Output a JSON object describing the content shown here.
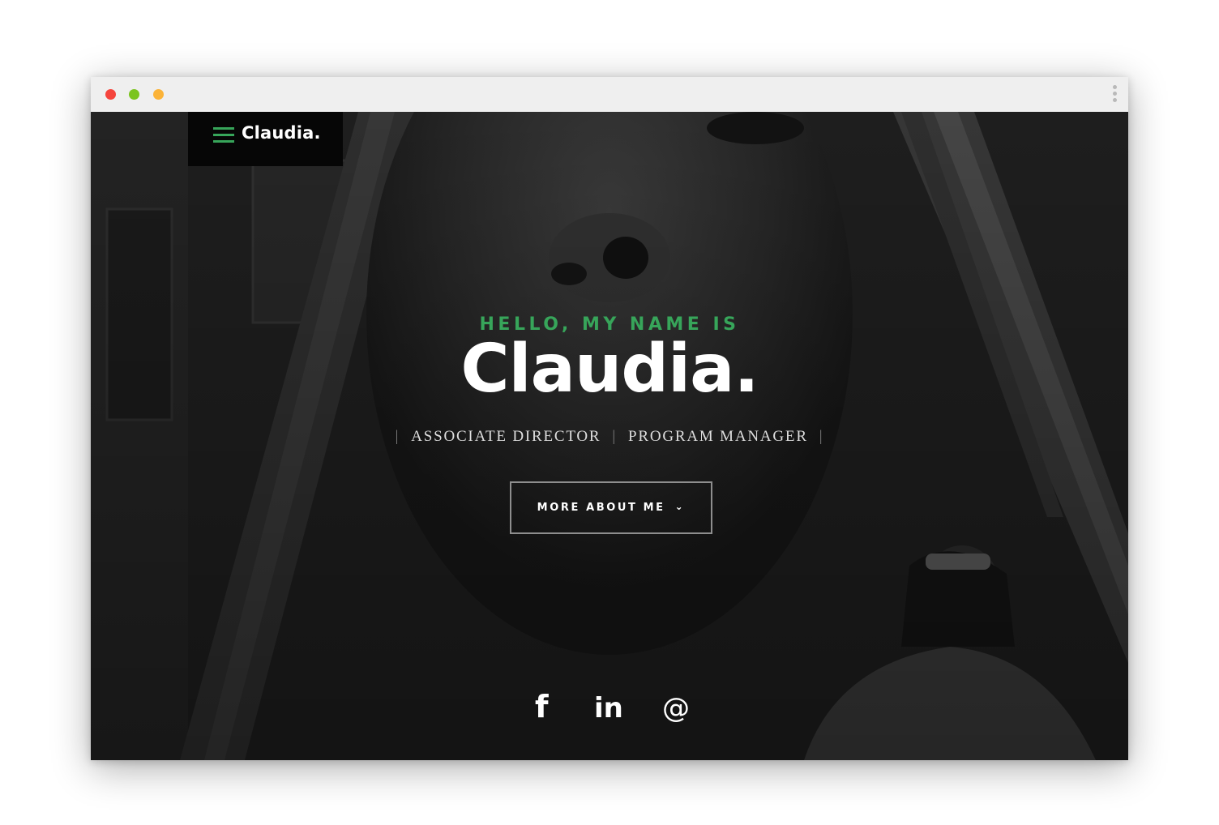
{
  "window": {
    "controls": [
      "close",
      "minimize",
      "maximize"
    ],
    "menu_icon": "kebab-menu-icon"
  },
  "header": {
    "menu_icon": "hamburger-icon",
    "brand": "Claudia."
  },
  "hero": {
    "greeting": "HELLO, MY NAME IS",
    "name": "Claudia.",
    "roles": [
      "ASSOCIATE DIRECTOR",
      "PROGRAM MANAGER"
    ],
    "role_separator": "|",
    "cta_label": "MORE ABOUT ME",
    "cta_icon": "chevron-down-icon"
  },
  "social": [
    {
      "name": "facebook",
      "icon": "facebook-icon",
      "glyph": "f"
    },
    {
      "name": "linkedin",
      "icon": "linkedin-icon",
      "glyph": "in"
    },
    {
      "name": "email",
      "icon": "email-icon",
      "glyph": "@"
    }
  ],
  "colors": {
    "accent": "#37a55a",
    "background": "#1e1e1e",
    "brand_box": "#060606",
    "titlebar": "#efefef"
  }
}
